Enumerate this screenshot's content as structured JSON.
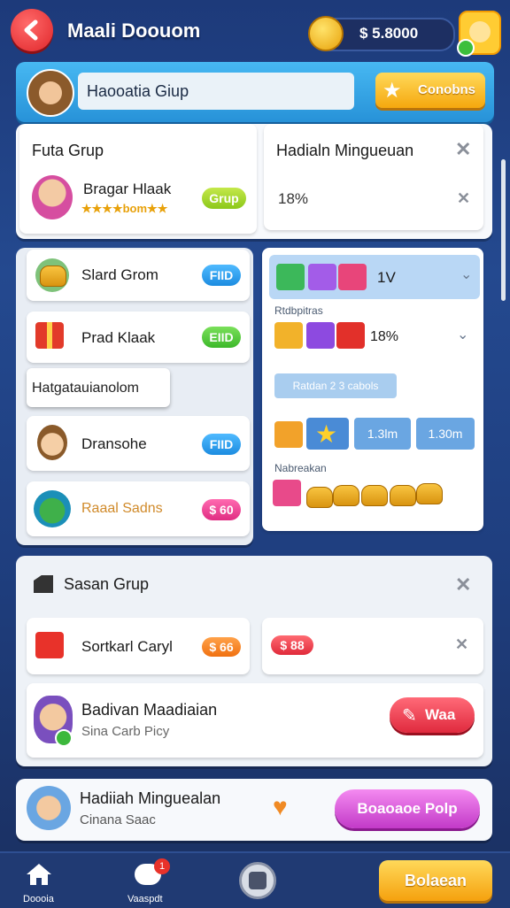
{
  "header": {
    "title": "Maali Doouom",
    "coins": "$ 5.8000"
  },
  "search_banner": {
    "label": "Haooatia Giup",
    "button": "Conobns"
  },
  "left_panel": {
    "title": "Futa Grup",
    "member_name": "Bragar Hlaak",
    "member_sub": "★★★★bom★★",
    "member_button": "Grup"
  },
  "right_panel": {
    "title": "Hadialn Mingueuan",
    "percent": "18%"
  },
  "list_items": [
    {
      "label": "Slard Grom",
      "button": "FIID"
    },
    {
      "label": "Prad Klaak",
      "button": "EIID"
    },
    {
      "label": "Dransohe",
      "button": "FIID"
    },
    {
      "label": "Raaal Sadns",
      "button": "$ 60"
    }
  ],
  "tooltip": "Hatgatauianolom",
  "rewards": {
    "top_count": "1V",
    "section1_label": "Rtdbpitras",
    "section1_percent": "18%",
    "tag_button": "Ratdan 2 3 cabols",
    "chip1": "1.3lm",
    "chip2": "1.30m",
    "section2_label": "Nabreakan"
  },
  "group_section": {
    "title": "Sasan Grup",
    "item_label": "Sortkarl Caryl",
    "item_button": "$ 66",
    "item2_button": "$ 88",
    "profile_name": "Badivan Maadiaian",
    "profile_sub": "Sina Carb Picy",
    "profile_button": "Waa"
  },
  "footer_card": {
    "name": "Hadiiah Minguealan",
    "sub": "Cinana Saac",
    "button": "Boaoaoe Polp"
  },
  "bottom_nav": {
    "home_label": "Doooia",
    "chat_label": "Vaaspdt",
    "chat_badge": "1",
    "action_button": "Bolaean"
  },
  "colors": {
    "accent_yellow": "#ffc21a",
    "accent_pink": "#e83e9a",
    "accent_red": "#e73a45",
    "button_blue": "#2aa3f0",
    "button_green": "#55c83a",
    "bg_blue": "#1f3f80"
  }
}
